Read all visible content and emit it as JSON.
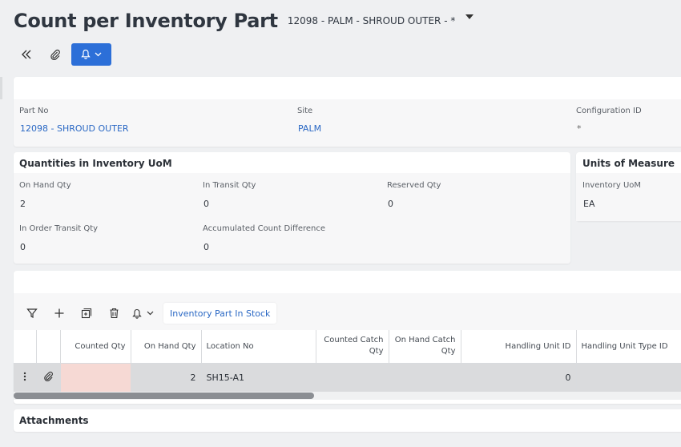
{
  "header": {
    "title": "Count per Inventory Part",
    "subtitle": "12098 - PALM - SHROUD OUTER - *"
  },
  "toolbar": {
    "collapse_icon": "double-chevron-left-icon",
    "attach_icon": "paperclip-icon",
    "bell_icon": "bell-icon"
  },
  "part_info": {
    "part_no_label": "Part No",
    "part_no_value": "12098 - SHROUD OUTER",
    "site_label": "Site",
    "site_value": "PALM",
    "config_label": "Configuration ID",
    "config_value": "*"
  },
  "quantities": {
    "title": "Quantities in Inventory UoM",
    "on_hand_label": "On Hand Qty",
    "on_hand_value": "2",
    "in_transit_label": "In Transit Qty",
    "in_transit_value": "0",
    "reserved_label": "Reserved Qty",
    "reserved_value": "0",
    "in_order_transit_label": "In Order Transit Qty",
    "in_order_transit_value": "0",
    "acc_count_diff_label": "Accumulated Count Difference",
    "acc_count_diff_value": "0"
  },
  "uom": {
    "title": "Units of Measure",
    "inventory_uom_label": "Inventory UoM",
    "inventory_uom_value": "EA"
  },
  "grid": {
    "tab_label": "Inventory Part In Stock",
    "columns": {
      "counted_qty": "Counted Qty",
      "on_hand_qty": "On Hand Qty",
      "location_no": "Location No",
      "counted_catch_qty_1": "Counted Catch",
      "counted_catch_qty_2": "Qty",
      "on_hand_catch_qty_1": "On Hand Catch",
      "on_hand_catch_qty_2": "Qty",
      "handling_unit_id": "Handling Unit ID",
      "handling_unit_type_id": "Handling Unit Type ID"
    },
    "rows": [
      {
        "counted_qty": "",
        "on_hand_qty": "2",
        "location_no": "SH15-A1",
        "counted_catch_qty": "",
        "on_hand_catch_qty": "",
        "handling_unit_id": "0",
        "handling_unit_type_id": ""
      }
    ]
  },
  "attachments": {
    "title": "Attachments"
  },
  "colors": {
    "accent": "#2c6fd8",
    "link": "#2a68c4",
    "editable_cell": "#f6d9d4",
    "row_bg": "#dadbdd"
  }
}
